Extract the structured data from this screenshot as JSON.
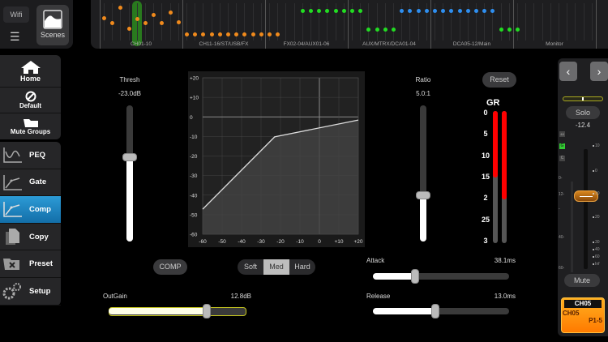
{
  "topbar": {
    "wifi": "Wifi",
    "scenes": "Scenes"
  },
  "meters": {
    "sections": [
      "CH01-10",
      "CH11-16/ST/USB/FX",
      "FX02-04/AUX01-06",
      "AUX/MTRX/DCA01-04",
      "DCA05-12/Main",
      "Monitor"
    ],
    "selected_channel": 4,
    "colors": {
      "orange": "#f08a1c",
      "green": "#22dd22",
      "blue": "#2f8ff0"
    },
    "runs": [
      {
        "start": 0,
        "color": "orange",
        "levels": [
          0.62,
          0.47,
          0.91,
          0.33,
          0.6,
          0.47,
          0.69,
          0.47,
          0.76,
          0.51
        ]
      },
      {
        "start": 10,
        "color": "orange",
        "levels": [
          0.16,
          0.16,
          0.16,
          0.16,
          0.16,
          0.16,
          0.16,
          0.16,
          0.16,
          0.16,
          0.16,
          0.16
        ]
      },
      {
        "start": 24,
        "color": "green",
        "levels": [
          0.82,
          0.82,
          0.82,
          0.82,
          0.82,
          0.82,
          0.82,
          0.82
        ]
      },
      {
        "start": 32,
        "color": "green",
        "levels": [
          0.31,
          0.31,
          0.31,
          0.31
        ]
      },
      {
        "start": 36,
        "color": "blue",
        "levels": [
          0.82,
          0.82,
          0.82,
          0.82,
          0.82,
          0.82,
          0.82,
          0.82,
          0.82,
          0.82,
          0.82,
          0.82
        ]
      },
      {
        "start": 48,
        "color": "green",
        "levels": [
          0.31,
          0.31,
          0.31
        ]
      }
    ]
  },
  "sidebar": {
    "top": [
      {
        "label": "Home",
        "icon": "home-icon"
      },
      {
        "label": "Default",
        "icon": "no-icon"
      },
      {
        "label": "Mute Groups",
        "icon": "folder-icon"
      }
    ],
    "items": [
      {
        "label": "PEQ",
        "icon": "peq-icon"
      },
      {
        "label": "Gate",
        "icon": "gate-icon"
      },
      {
        "label": "Comp",
        "icon": "comp-icon",
        "active": true
      },
      {
        "label": "Copy",
        "icon": "copy-icon"
      },
      {
        "label": "Preset",
        "icon": "preset-icon"
      },
      {
        "label": "Setup",
        "icon": "gear-icon"
      }
    ]
  },
  "comp": {
    "thresh": {
      "label": "Thresh",
      "value": "-23.0dB",
      "db": -23,
      "fraction": 0.62
    },
    "ratio": {
      "label": "Ratio",
      "value": "5.0:1",
      "ratio": 5,
      "fraction": 0.34
    },
    "reset": "Reset",
    "comp_button": "COMP",
    "knee": {
      "options": [
        "Soft",
        "Med",
        "Hard"
      ],
      "selected": "Med"
    },
    "outgain": {
      "label": "OutGain",
      "value": "12.8dB",
      "db": 12.8,
      "fraction": 0.71
    },
    "attack": {
      "label": "Attack",
      "value": "38.1ms",
      "fraction": 0.31
    },
    "release": {
      "label": "Release",
      "value": "13.0ms",
      "fraction": 0.46
    },
    "graph": {
      "y_ticks": [
        "+20",
        "+10",
        "0",
        "-10",
        "-20",
        "-30",
        "-40",
        "-50",
        "-60"
      ],
      "x_ticks": [
        "-60",
        "-50",
        "-40",
        "-30",
        "-20",
        "-10",
        "0",
        "+10",
        "+20"
      ]
    },
    "gr": {
      "title": "GR",
      "scale": [
        "0",
        "5",
        "10",
        "15",
        "2",
        "25",
        "3"
      ],
      "levels": [
        0.5,
        0.67
      ]
    }
  },
  "channel": {
    "solo": "Solo",
    "level": "-12.4",
    "badges": [
      "48",
      "G",
      "C"
    ],
    "scale": [
      "10",
      "0",
      "10",
      "20",
      "30",
      "40",
      "60",
      "Inf"
    ],
    "left_scale": [
      "0-",
      "12-",
      "-",
      "40-",
      "60-"
    ],
    "mute": "Mute",
    "name": "CH05",
    "label": "CH05",
    "patch": "P1-5",
    "fader_fraction": 0.47
  }
}
